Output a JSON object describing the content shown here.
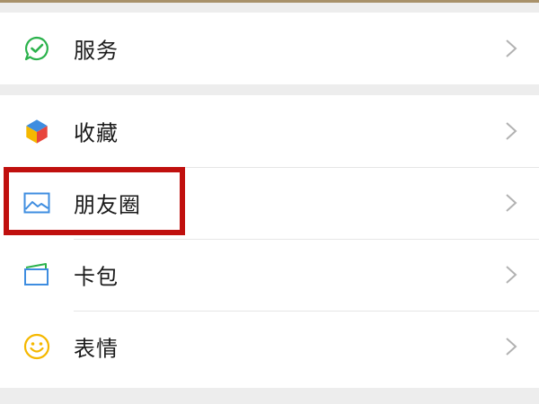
{
  "menu": {
    "groups": [
      {
        "items": [
          {
            "label": "服务",
            "icon": "services-icon"
          }
        ]
      },
      {
        "items": [
          {
            "label": "收藏",
            "icon": "favorites-icon"
          },
          {
            "label": "朋友圈",
            "icon": "moments-icon"
          },
          {
            "label": "卡包",
            "icon": "card-wallet-icon"
          },
          {
            "label": "表情",
            "icon": "stickers-icon"
          }
        ]
      }
    ]
  },
  "colors": {
    "services": "#2bb24c",
    "moments": "#3e8de0",
    "wallet": "#3e8de0",
    "stickers": "#f5b800",
    "highlight": "#c0100e",
    "chevron": "#b2b2b2"
  }
}
